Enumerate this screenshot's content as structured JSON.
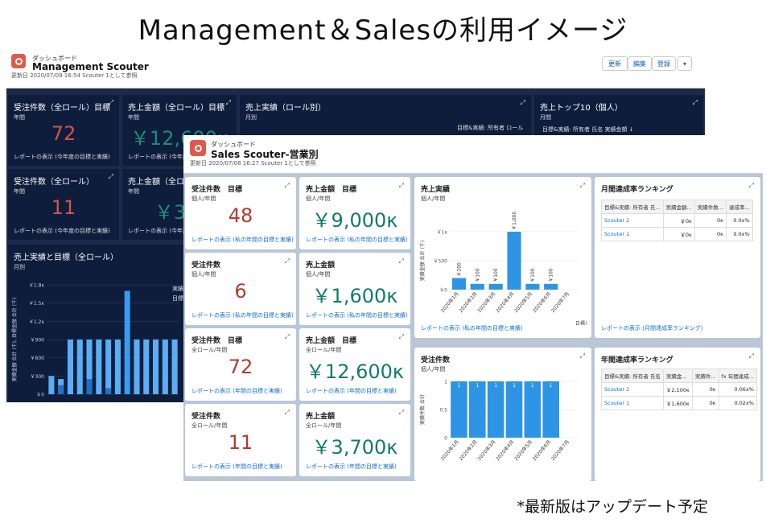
{
  "slide": {
    "title": "Management＆Salesの利用イメージ",
    "footnote": "*最新版はアップデート予定"
  },
  "back": {
    "kicker": "ダッシュボード",
    "title": "Management Scouter",
    "updated": "更新日 2020/07/09 16:54 Scouter 1として参照",
    "buttons": [
      "更新",
      "編集",
      "登録",
      "▾"
    ],
    "cards": [
      {
        "title": "受注件数（全ロール）目標",
        "sub": "年間",
        "value": "72",
        "link": "レポートの表示 (今年度の目標と実績)"
      },
      {
        "title": "売上金額（全ロール）目標",
        "sub": "年間",
        "value": "￥12,600κ",
        "link": "レポートの表示 (今年度の目標と実績)"
      },
      {
        "title": "受注件数（全ロール）",
        "sub": "年間",
        "value": "11",
        "link": "レポートの表示 (今年度の目標と実績)"
      },
      {
        "title": "売上金額（全ロ",
        "sub": "年間",
        "value": "￥3,7",
        "link": "レポートの表示 (今年度の"
      },
      {
        "title": "売上実績（ロール別）",
        "sub": "月別",
        "note": "目標&実績: 所有者 ロール"
      },
      {
        "title": "売上トップ10（個人）",
        "sub": "月間",
        "note": "目標&実績: 所有者 氏名   実績金額 ↓"
      },
      {
        "title": "売上実績と目標（全ロール）",
        "sub": "月別",
        "note1": "実績金",
        "note2": "目標金"
      }
    ],
    "chart": {
      "yticks": [
        "￥1.8κ",
        "￥1.5κ",
        "￥1.2κ",
        "￥900",
        "￥600",
        "￥300",
        "￥0"
      ],
      "ylabel": "実績金額 合計 (千), 目標金額 合計 (千)"
    }
  },
  "front": {
    "kicker": "ダッシュボード",
    "title": "Sales Scouter-営業別",
    "updated": "更新日 2020/07/08 16:27 Scouter 1として参照",
    "cards": [
      {
        "title": "受注件数　目標",
        "sub": "個人/年間",
        "value": "48",
        "link": "レポートの表示 (私の年間の目標と実績)"
      },
      {
        "title": "売上金額　目標",
        "sub": "個人/年間",
        "value": "￥9,000κ",
        "link": "レポートの表示 (私の年間の目標と実績)"
      },
      {
        "title": "受注件数",
        "sub": "個人/年間",
        "value": "6",
        "link": "レポートの表示 (私の年間の目標と実績)"
      },
      {
        "title": "売上金額",
        "sub": "個人/年間",
        "value": "￥1,600κ",
        "link": "レポートの表示 (私の年間の目標と実績)"
      },
      {
        "title": "受注件数　目標",
        "sub": "全ロール/年間",
        "value": "72",
        "link": "レポートの表示 (年間の目標と実績)"
      },
      {
        "title": "売上金額　目標",
        "sub": "全ロール/年間",
        "value": "￥12,600κ",
        "link": "レポートの表示 (年間の目標と実績)"
      },
      {
        "title": "受注件数",
        "sub": "全ロール/年間",
        "value": "11",
        "link": "レポートの表示 (年間の目標と実績)"
      },
      {
        "title": "売上金額",
        "sub": "全ロール/年間",
        "value": "￥3,700κ",
        "link": "レポートの表示 (年間の目標と実績)"
      }
    ],
    "sales_chart": {
      "title": "売上実績",
      "sub": "個人/年間",
      "link": "レポートの表示 (私の年間の目標と実績)",
      "xlabel": "日標月",
      "ylabel": "実績金額 合計 (千)"
    },
    "count_chart": {
      "title": "受注件数",
      "sub": "個人/年間",
      "ylabel": "実績件数 合計"
    },
    "monthly_rank": {
      "title": "月間達成率ランキング",
      "link": "レポートの表示 (月間達成率ランキング)",
      "headers": [
        "目標&実績: 所有者 氏...",
        "実績金額...",
        "実績件数...",
        "達成率..."
      ],
      "rows": [
        [
          "Scouter 2",
          "￥0κ",
          "0κ",
          "0.0x%"
        ],
        [
          "Scouter 1",
          "￥0κ",
          "0κ",
          "0.0x%"
        ]
      ]
    },
    "annual_rank": {
      "title": "年間達成率ランキング",
      "headers": [
        "目標&実績: 所有者 氏名",
        "実績金...",
        "実績件...",
        "fx 年間達成..."
      ],
      "rows": [
        [
          "Scouter 2",
          "￥2,100κ",
          "0κ",
          "0.06x%"
        ],
        [
          "Scouter 1",
          "￥1,600κ",
          "0κ",
          "0.02x%"
        ]
      ]
    }
  },
  "chart_data": [
    {
      "type": "bar",
      "categories": [
        "2020年1月",
        "2020年2月",
        "2020年3月",
        "2020年4月",
        "2020年5月",
        "2020年6月",
        "2020年7月"
      ],
      "series": [
        {
          "values": [
            200,
            100,
            100,
            1000,
            100,
            100,
            0
          ]
        }
      ],
      "data_labels": [
        "￥200",
        "￥100",
        "￥100",
        "￥1,000",
        "￥100",
        "￥100",
        ""
      ],
      "yticks": [
        "￥0",
        "￥500",
        "￥1κ"
      ],
      "ylim": [
        0,
        1000
      ],
      "xlabel": "日標月",
      "ylabel": "実績金額 合計 (千)"
    },
    {
      "type": "bar",
      "categories": [
        "2020年1月",
        "2020年2月",
        "2020年3月",
        "2020年4月",
        "2020年5月",
        "2020年6月",
        "2020年7月"
      ],
      "series": [
        {
          "values": [
            1,
            1,
            1,
            1,
            1,
            1,
            0
          ]
        }
      ],
      "data_labels": [
        "1",
        "1",
        "1",
        "1",
        "1",
        "1",
        ""
      ],
      "yticks": [
        "0",
        "0.5",
        "1"
      ],
      "ylim": [
        0,
        1
      ],
      "ylabel": "実績件数 合計"
    },
    {
      "type": "bar",
      "series": [
        {
          "values": [
            300,
            250,
            900,
            900,
            900,
            900,
            900,
            900,
            1700,
            900,
            900,
            900,
            900,
            900
          ]
        },
        {
          "values": [
            0,
            150,
            0,
            0,
            250,
            0,
            100,
            0,
            0,
            0,
            0,
            0,
            0,
            0
          ]
        }
      ],
      "yticks": [
        "￥1.8κ",
        "￥1.5κ",
        "￥1.2κ",
        "￥900",
        "￥600",
        "￥300",
        "￥0"
      ],
      "ylim": [
        0,
        1800
      ],
      "ylabel": "実績金額 合計 (千), 目標金額 合計 (千)"
    }
  ]
}
